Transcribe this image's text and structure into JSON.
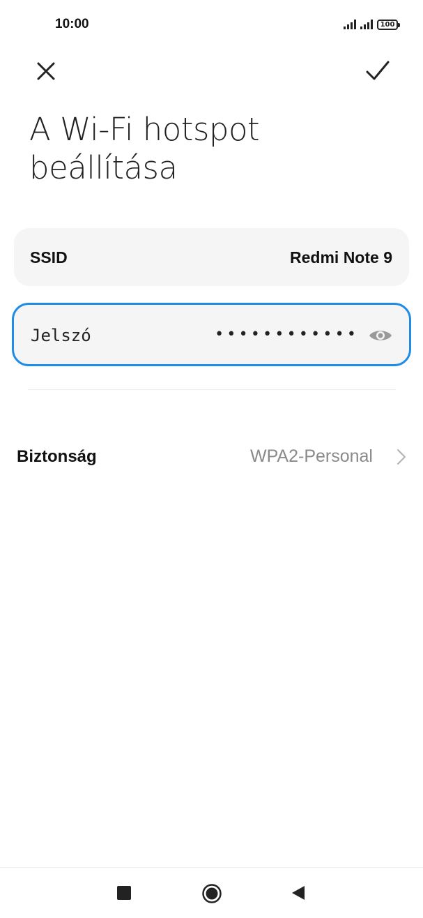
{
  "status_bar": {
    "time": "10:00",
    "battery": "100"
  },
  "toolbar": {
    "close_icon": "close-icon",
    "confirm_icon": "check-icon"
  },
  "title": "A Wi-Fi hotspot beállítása",
  "ssid": {
    "label": "SSID",
    "value": "Redmi Note 9"
  },
  "password": {
    "label": "Jelszó",
    "masked_value": "••••••••••••",
    "visibility_icon": "eye-icon"
  },
  "security": {
    "label": "Biztonság",
    "value": "WPA2-Personal",
    "icon": "chevron-right-icon"
  },
  "colors": {
    "accent": "#1f8ce6",
    "card_background": "#f5f5f5",
    "secondary_text": "#8a8a8a"
  }
}
